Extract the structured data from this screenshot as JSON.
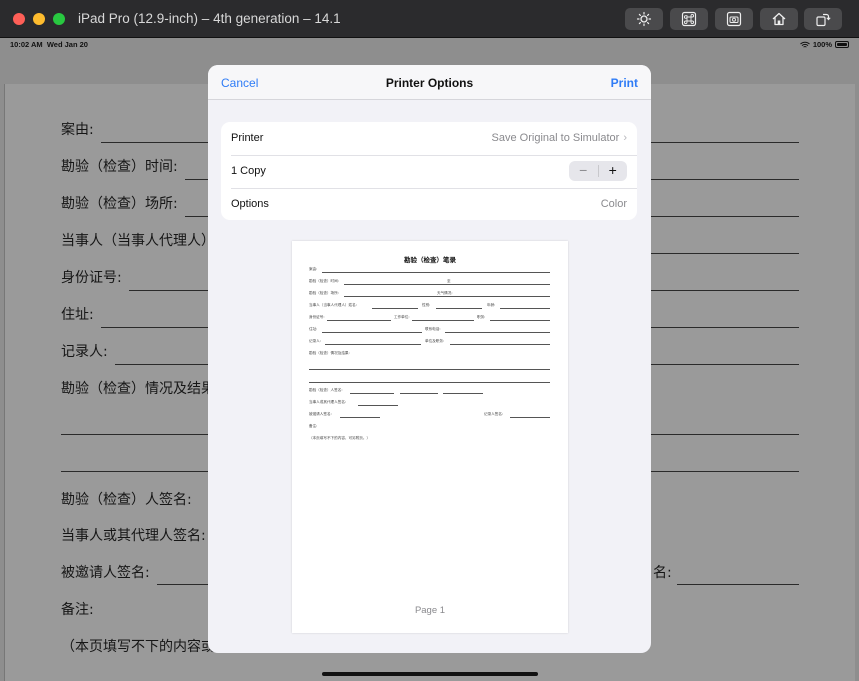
{
  "window": {
    "title": "iPad Pro (12.9-inch) – 4th generation – 14.1",
    "toolbar_icons": [
      "brightness-icon",
      "command-icon",
      "screenshot-icon",
      "home-icon",
      "rotate-icon"
    ]
  },
  "statusbar": {
    "time": "10:02 AM",
    "date": "Wed Jan 20",
    "battery": "100%"
  },
  "background_doc": {
    "rows": [
      "案由:",
      "勘验（检查）时间:",
      "勘验（检查）场所:",
      "当事人（当事人代理人）",
      "身份证号:",
      "住址:",
      "记录人:",
      "勘验（检查）情况及结果",
      "勘验（检查）人签名:",
      "当事人或其代理人签名:",
      "被邀请人签名:",
      "备注:",
      "（本页填写不下的内容或"
    ],
    "right_label": "名:"
  },
  "sheet": {
    "cancel": "Cancel",
    "title": "Printer Options",
    "print": "Print",
    "printer_label": "Printer",
    "printer_value": "Save Original to Simulator",
    "copies_label": "1 Copy",
    "stepper_minus": "−",
    "stepper_plus": "+",
    "options_label": "Options",
    "options_value": "Color",
    "page_label": "Page 1"
  },
  "preview": {
    "title": "勘验（检查）笔录",
    "rows": [
      "案由:",
      "勘验（检查）时间:",
      "勘验（检查）场所:",
      "当事人（当事人代理人）姓名:",
      "身份证号:",
      "住址:",
      "记录人:",
      "勘验（检查）情况及结果:",
      "勘验（检查）人签名:",
      "当事人或其代理人签名:",
      "被邀请人签名:",
      "备注:",
      "（本页填写不下的内容，可另附页。）"
    ],
    "inline_labels": [
      "至",
      "天气情况:",
      "性别:",
      "年龄:",
      "工作单位:",
      "职务:",
      "联系电话:",
      "单位及职务:",
      "记录人签名:"
    ]
  }
}
